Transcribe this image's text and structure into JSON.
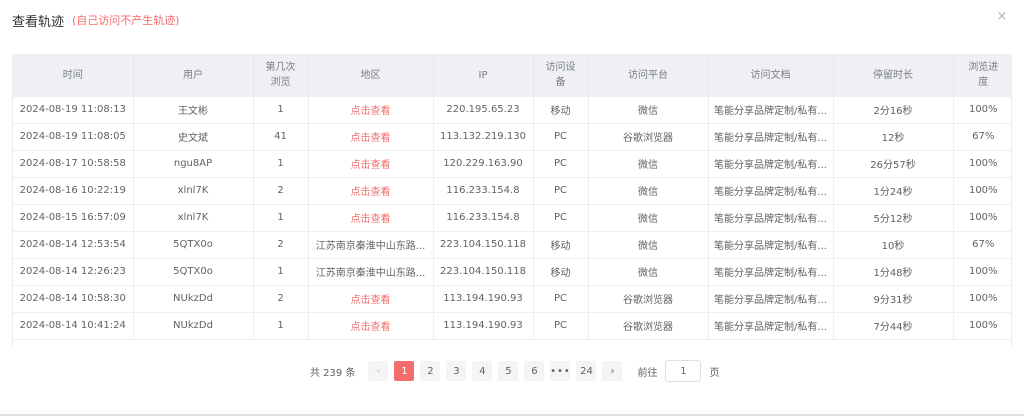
{
  "dialog": {
    "title": "查看轨迹",
    "note": "(自己访问不产生轨迹)",
    "close_symbol": "×"
  },
  "table": {
    "headers": [
      "时间",
      "用户",
      "第几次\n浏览",
      "地区",
      "IP",
      "访问设\n备",
      "访问平台",
      "访问文档",
      "停留时长",
      "浏览进\n度"
    ],
    "rows": [
      [
        "2024-08-19 11:08:13",
        "王文彬",
        "1",
        "点击查看",
        "220.195.65.23",
        "移动",
        "微信",
        "笔能分享品牌定制/私有...",
        "2分16秒",
        "100%"
      ],
      [
        "2024-08-19 11:08:05",
        "史文斌",
        "41",
        "点击查看",
        "113.132.219.130",
        "PC",
        "谷歌浏览器",
        "笔能分享品牌定制/私有...",
        "12秒",
        "67%"
      ],
      [
        "2024-08-17 10:58:58",
        "ngu8AP",
        "1",
        "点击查看",
        "120.229.163.90",
        "PC",
        "微信",
        "笔能分享品牌定制/私有...",
        "26分57秒",
        "100%"
      ],
      [
        "2024-08-16 10:22:19",
        "xlnl7K",
        "2",
        "点击查看",
        "116.233.154.8",
        "PC",
        "微信",
        "笔能分享品牌定制/私有...",
        "1分24秒",
        "100%"
      ],
      [
        "2024-08-15 16:57:09",
        "xlnl7K",
        "1",
        "点击查看",
        "116.233.154.8",
        "PC",
        "微信",
        "笔能分享品牌定制/私有...",
        "5分12秒",
        "100%"
      ],
      [
        "2024-08-14 12:53:54",
        "5QTX0o",
        "2",
        "江苏南京秦淮中山东路...",
        "223.104.150.118",
        "移动",
        "微信",
        "笔能分享品牌定制/私有...",
        "10秒",
        "67%"
      ],
      [
        "2024-08-14 12:26:23",
        "5QTX0o",
        "1",
        "江苏南京秦淮中山东路...",
        "223.104.150.118",
        "移动",
        "微信",
        "笔能分享品牌定制/私有...",
        "1分48秒",
        "100%"
      ],
      [
        "2024-08-14 10:58:30",
        "NUkzDd",
        "2",
        "点击查看",
        "113.194.190.93",
        "PC",
        "谷歌浏览器",
        "笔能分享品牌定制/私有...",
        "9分31秒",
        "100%"
      ],
      [
        "2024-08-14 10:41:24",
        "NUkzDd",
        "1",
        "点击查看",
        "113.194.190.93",
        "PC",
        "谷歌浏览器",
        "笔能分享品牌定制/私有...",
        "7分44秒",
        "100%"
      ]
    ],
    "link_text": "点击查看"
  },
  "pagination": {
    "total": "共 239 条",
    "prev_symbol": "‹",
    "next_symbol": "›",
    "pages": [
      "1",
      "2",
      "3",
      "4",
      "5",
      "6",
      "•••",
      "24"
    ],
    "current_page": "1",
    "goto_label": "前往",
    "goto_value": "1",
    "page_unit": "页"
  },
  "colors": {
    "accent": "#f56c6c",
    "header_bg": "#eef0f3",
    "border": "#ebeef5"
  }
}
